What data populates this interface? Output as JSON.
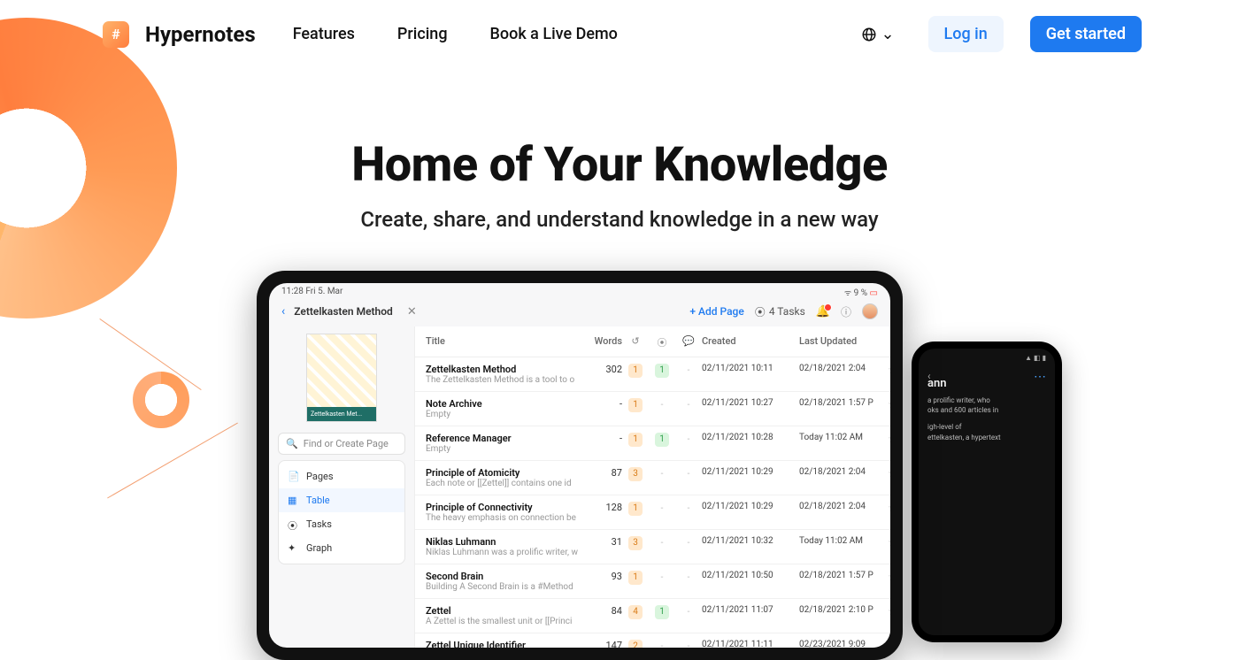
{
  "brand": {
    "name": "Hypernotes",
    "mark": "#"
  },
  "nav": {
    "features": "Features",
    "pricing": "Pricing",
    "demo": "Book a Live Demo"
  },
  "header": {
    "login": "Log in",
    "cta": "Get started"
  },
  "hero": {
    "title": "Home of Your Knowledge",
    "subtitle": "Create, share, and understand knowledge in a new way"
  },
  "tablet": {
    "status_left": "11:28   Fri 5. Mar",
    "status_right": "9 %",
    "doc_title": "Zettelkasten Method",
    "add_page": "Add Page",
    "tasks": "4 Tasks",
    "thumb_label": "Zettelkasten Met...",
    "search_placeholder": "Find or Create Page",
    "menu": {
      "pages": "Pages",
      "table": "Table",
      "tasks": "Tasks",
      "graph": "Graph"
    },
    "columns": {
      "title": "Title",
      "words": "Words",
      "created": "Created",
      "updated": "Last Updated"
    },
    "rows": [
      {
        "title": "Zettelkasten Method",
        "sub": "The Zettelkasten Method is a tool to o",
        "words": "302",
        "b1": "1",
        "b2": "1",
        "b3": "-",
        "created": "02/11/2021 10:11",
        "updated": "02/18/2021 2:04"
      },
      {
        "title": "Note Archive",
        "sub": "Empty",
        "words": "-",
        "b1": "1",
        "b2": "-",
        "b3": "-",
        "created": "02/11/2021 10:27",
        "updated": "02/18/2021 1:57 P"
      },
      {
        "title": "Reference Manager",
        "sub": "Empty",
        "words": "-",
        "b1": "1",
        "b2": "1",
        "b3": "-",
        "created": "02/11/2021 10:28",
        "updated": "Today 11:02 AM"
      },
      {
        "title": "Principle of Atomicity",
        "sub": "Each note or [[Zettel]] contains one id",
        "words": "87",
        "b1": "3",
        "b2": "-",
        "b3": "-",
        "created": "02/11/2021 10:29",
        "updated": "02/18/2021 2:04"
      },
      {
        "title": "Principle of Connectivity",
        "sub": "The heavy emphasis on connection be",
        "words": "128",
        "b1": "1",
        "b2": "-",
        "b3": "-",
        "created": "02/11/2021 10:29",
        "updated": "02/18/2021 2:04"
      },
      {
        "title": "Niklas Luhmann",
        "sub": "Niklas Luhmann was a prolific writer, w",
        "words": "31",
        "b1": "3",
        "b2": "-",
        "b3": "-",
        "created": "02/11/2021 10:32",
        "updated": "Today 11:02 AM"
      },
      {
        "title": "Second Brain",
        "sub": "Building A Second Brain is a #Method",
        "words": "93",
        "b1": "1",
        "b2": "-",
        "b3": "-",
        "created": "02/11/2021 10:50",
        "updated": "02/18/2021 1:57 P"
      },
      {
        "title": "Zettel",
        "sub": "A Zettel is the smallest unit or [[Princi",
        "words": "84",
        "b1": "4",
        "b2": "1",
        "b3": "-",
        "created": "02/11/2021 11:07",
        "updated": "02/18/2021 2:10 P"
      },
      {
        "title": "Zettel Unique Identifier",
        "sub": "",
        "words": "147",
        "b1": "2",
        "b2": "-",
        "b3": "-",
        "created": "02/11/2021 11:11",
        "updated": "02/23/2021 9:09"
      }
    ]
  },
  "phone": {
    "title_suffix": "ann",
    "line1": "a prolific writer, who",
    "line2": "oks and 600 articles in",
    "line3": "igh-level of",
    "line4": "ettelkasten, a hypertext"
  }
}
